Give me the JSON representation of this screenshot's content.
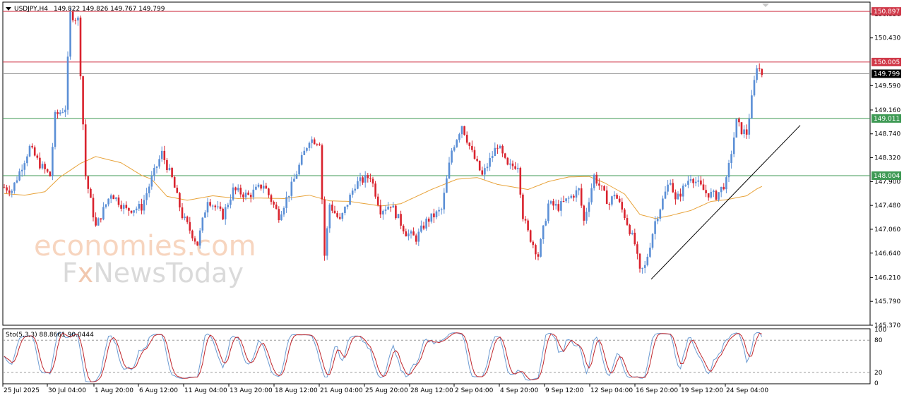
{
  "header": {
    "symbol": "USDJPY,H4",
    "ohlc": "149.822 149.826 149.767 149.799"
  },
  "watermark": {
    "line1": "economies.com",
    "line2_a": "F",
    "line2_b": "x",
    "line2_c": "NewsToday"
  },
  "colors": {
    "bull": "#5b8fd6",
    "bear": "#d9232e",
    "ma": "#e8a33a",
    "resistance": "#d03a4a",
    "support": "#3f9a55",
    "price_line": "#999999",
    "stoch_main": "#6c9bd2",
    "stoch_signal": "#c0282e"
  },
  "chart_data": {
    "type": "candlestick",
    "title": "USDJPY,H4",
    "ylim": [
      145.37,
      151.06
    ],
    "y_ticks": [
      "150.850",
      "150.430",
      "149.590",
      "149.160",
      "148.740",
      "148.320",
      "147.900",
      "147.480",
      "147.060",
      "146.640",
      "146.210",
      "145.790",
      "145.370"
    ],
    "x_ticks": [
      "25 Jul 2025",
      "30 Jul 04:00",
      "1 Aug 20:00",
      "6 Aug 12:00",
      "11 Aug 04:00",
      "13 Aug 20:00",
      "18 Aug 12:00",
      "21 Aug 04:00",
      "25 Aug 20:00",
      "28 Aug 12:00",
      "2 Sep 04:00",
      "4 Sep 20:00",
      "9 Sep 12:00",
      "12 Sep 04:00",
      "16 Sep 20:00",
      "19 Sep 12:00",
      "24 Sep 04:00"
    ],
    "horizontal_levels": [
      {
        "label": "150.897",
        "value": 150.897,
        "kind": "resistance"
      },
      {
        "label": "150.005",
        "value": 150.005,
        "kind": "resistance"
      },
      {
        "label": "149.011",
        "value": 149.011,
        "kind": "support"
      },
      {
        "label": "148.004",
        "value": 148.004,
        "kind": "support"
      }
    ],
    "current_price": {
      "label": "149.799",
      "value": 149.799
    },
    "trendline": {
      "from": [
        146.18,
        "16 Sep 20:00"
      ],
      "to": [
        148.89,
        "after 24 Sep 04:00"
      ]
    },
    "moving_average_knots": [
      [
        0,
        147.69
      ],
      [
        8,
        147.66
      ],
      [
        16,
        147.72
      ],
      [
        22,
        147.98
      ],
      [
        30,
        148.22
      ],
      [
        36,
        148.34
      ],
      [
        46,
        148.23
      ],
      [
        54,
        148.01
      ],
      [
        58,
        147.94
      ],
      [
        64,
        147.64
      ],
      [
        72,
        147.57
      ],
      [
        82,
        147.65
      ],
      [
        92,
        147.6
      ],
      [
        100,
        147.61
      ],
      [
        110,
        147.6
      ],
      [
        120,
        147.66
      ],
      [
        128,
        147.56
      ],
      [
        136,
        147.55
      ],
      [
        148,
        147.47
      ],
      [
        156,
        147.51
      ],
      [
        168,
        147.76
      ],
      [
        178,
        147.94
      ],
      [
        186,
        147.97
      ],
      [
        194,
        147.85
      ],
      [
        206,
        147.76
      ],
      [
        214,
        147.9
      ],
      [
        222,
        147.98
      ],
      [
        230,
        147.99
      ],
      [
        236,
        147.88
      ],
      [
        244,
        147.68
      ],
      [
        250,
        147.32
      ],
      [
        256,
        147.25
      ],
      [
        262,
        147.3
      ],
      [
        270,
        147.39
      ],
      [
        278,
        147.55
      ],
      [
        284,
        147.58
      ],
      [
        292,
        147.65
      ],
      [
        296,
        147.77
      ],
      [
        300,
        147.86
      ]
    ],
    "close_knots": [
      [
        0,
        147.8
      ],
      [
        3,
        147.75
      ],
      [
        10,
        148.5
      ],
      [
        14,
        148.2
      ],
      [
        18,
        148.0
      ],
      [
        20,
        149.05
      ],
      [
        24,
        149.2
      ],
      [
        26,
        150.85
      ],
      [
        29,
        150.75
      ],
      [
        32,
        148.0
      ],
      [
        36,
        147.1
      ],
      [
        42,
        147.7
      ],
      [
        48,
        147.4
      ],
      [
        54,
        147.45
      ],
      [
        58,
        147.95
      ],
      [
        62,
        148.4
      ],
      [
        66,
        147.95
      ],
      [
        70,
        147.3
      ],
      [
        76,
        146.8
      ],
      [
        80,
        147.6
      ],
      [
        86,
        147.3
      ],
      [
        90,
        147.75
      ],
      [
        96,
        147.65
      ],
      [
        102,
        147.85
      ],
      [
        108,
        147.3
      ],
      [
        112,
        147.7
      ],
      [
        120,
        148.65
      ],
      [
        124,
        148.6
      ],
      [
        126,
        146.6
      ],
      [
        128,
        147.5
      ],
      [
        132,
        147.2
      ],
      [
        138,
        147.85
      ],
      [
        144,
        148.0
      ],
      [
        148,
        147.4
      ],
      [
        152,
        147.5
      ],
      [
        158,
        147.0
      ],
      [
        162,
        146.9
      ],
      [
        166,
        147.2
      ],
      [
        172,
        147.4
      ],
      [
        176,
        148.45
      ],
      [
        180,
        148.9
      ],
      [
        184,
        148.4
      ],
      [
        188,
        148.0
      ],
      [
        194,
        148.55
      ],
      [
        198,
        148.15
      ],
      [
        202,
        148.2
      ],
      [
        204,
        147.3
      ],
      [
        206,
        147.0
      ],
      [
        210,
        146.6
      ],
      [
        214,
        147.5
      ],
      [
        218,
        147.45
      ],
      [
        226,
        147.75
      ],
      [
        228,
        147.2
      ],
      [
        232,
        148.0
      ],
      [
        238,
        147.5
      ],
      [
        240,
        147.7
      ],
      [
        244,
        147.3
      ],
      [
        248,
        146.8
      ],
      [
        250,
        146.3
      ],
      [
        252,
        146.4
      ],
      [
        256,
        147.2
      ],
      [
        262,
        147.95
      ],
      [
        264,
        147.55
      ],
      [
        270,
        148.0
      ],
      [
        276,
        147.7
      ],
      [
        280,
        147.65
      ],
      [
        284,
        147.9
      ],
      [
        288,
        148.95
      ],
      [
        290,
        148.8
      ],
      [
        292,
        148.75
      ],
      [
        294,
        149.35
      ],
      [
        296,
        149.95
      ],
      [
        298,
        149.8
      ]
    ],
    "candle_count": 299,
    "stochastic": {
      "label": "Sto(5,3,3) 88.8661 90.0444",
      "main": 88.8661,
      "signal": 90.0444,
      "ylim": [
        0,
        100
      ],
      "ticks": [
        "100",
        "80",
        "20",
        "0"
      ],
      "levels": [
        80,
        20
      ]
    }
  }
}
